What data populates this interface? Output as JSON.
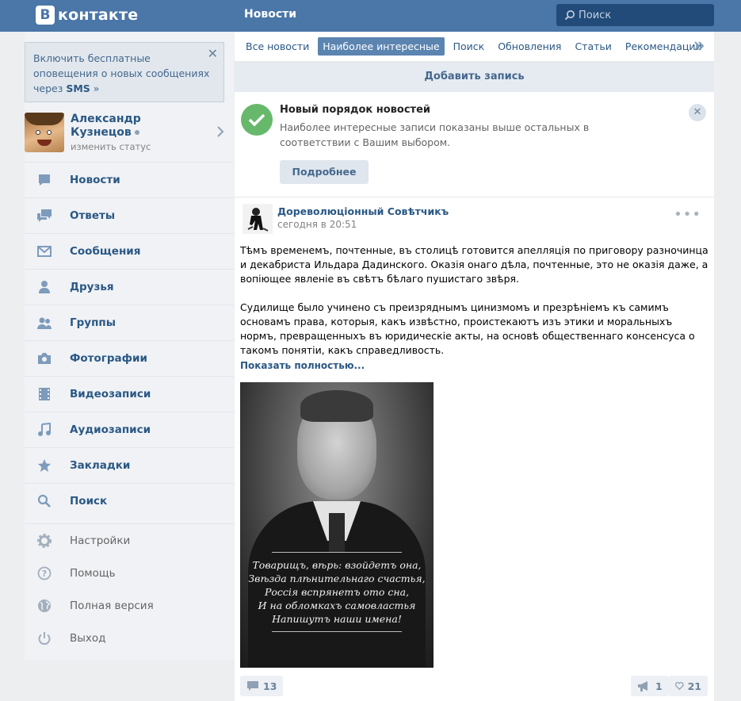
{
  "header": {
    "logo_letter": "В",
    "logo_text": "контакте",
    "title": "Новости",
    "search_placeholder": "Поиск"
  },
  "sms_notice": {
    "text": "Включить бесплатные оповещения о новых сообщениях через",
    "highlight": "SMS",
    "suffix": "»"
  },
  "profile": {
    "name_line1": "Александр",
    "name_line2": "Кузнецов",
    "status_link": "изменить статус"
  },
  "menu": [
    {
      "label": "Новости",
      "icon": "news-icon"
    },
    {
      "label": "Ответы",
      "icon": "replies-icon"
    },
    {
      "label": "Сообщения",
      "icon": "messages-icon"
    },
    {
      "label": "Друзья",
      "icon": "friends-icon"
    },
    {
      "label": "Группы",
      "icon": "groups-icon"
    },
    {
      "label": "Фотографии",
      "icon": "camera-icon"
    },
    {
      "label": "Видеозаписи",
      "icon": "film-icon"
    },
    {
      "label": "Аудиозаписи",
      "icon": "music-note-icon"
    },
    {
      "label": "Закладки",
      "icon": "star-icon"
    },
    {
      "label": "Поиск",
      "icon": "search-icon"
    }
  ],
  "menu_secondary": [
    {
      "label": "Настройки",
      "icon": "gear-icon"
    },
    {
      "label": "Помощь",
      "icon": "help-icon"
    },
    {
      "label": "Полная версия",
      "icon": "globe-icon"
    },
    {
      "label": "Выход",
      "icon": "power-icon"
    }
  ],
  "tabs": [
    "Все новости",
    "Наиболее интересные",
    "Поиск",
    "Обновления",
    "Статьи",
    "Рекомендации"
  ],
  "active_tab": "Наиболее интересные",
  "add_post": "Добавить запись",
  "notice": {
    "title": "Новый порядок новостей",
    "text": "Наиболее интересные записи показаны выше остальных в соответствии с Вашим выбором.",
    "button": "Подробнее"
  },
  "post": {
    "author": "Дореволюціонный Совѣтчикъ",
    "date": "сегодня в 20:51",
    "paragraph1": "Тѣмъ временемъ, почтенные, въ столицѣ готовится апелляція по приговору разночинца и декабриста Ильдара Дадинского. Оказія онаго дѣла, почтенные, это не оказія даже, а вопіющее явленіе въ свѣтъ бѣлаго пушистаго звѣря.",
    "paragraph2": "Судилище было учинено съ преизряднымъ цинизмомъ и презрѣніемъ къ самимъ основамъ права, которыя, какъ извѣстно, проистекаютъ изъ этики и моральныхъ нормъ, превращенныхъ въ юридическіе акты, на основѣ общественнаго консенсуса о такомъ понятіи, какъ справедливость.",
    "show_more": "Показать полностью...",
    "image_text": [
      "Товарищъ, вѣрь: взойдетъ она,",
      "Звѣзда плѣнительнаго счастья,",
      "Россія вспрянетъ ото сна,",
      "И на обломкахъ самовластья",
      "Напишутъ наши имена!"
    ],
    "comments": "13",
    "shares": "1",
    "likes": "21"
  },
  "colors": {
    "header_bg": "#4a76a8",
    "link": "#2a5885",
    "active_tab": "#5b84b1",
    "success": "#67b86b"
  }
}
